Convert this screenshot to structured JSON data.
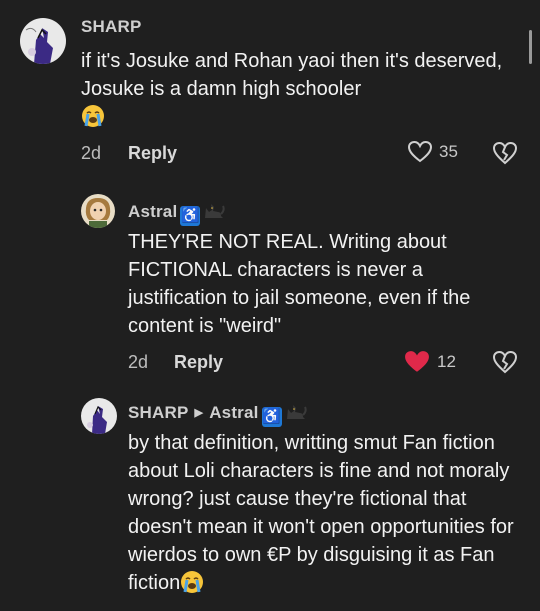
{
  "comments": [
    {
      "username": "SHARP",
      "text": "if it's Josuke and Rohan yaoi then it's deserved, Josuke is a damn high schooler",
      "time": "2d",
      "reply_label": "Reply",
      "likes": "35",
      "liked": false
    },
    {
      "username": "Astral",
      "badge": "♿",
      "text": "THEY'RE NOT REAL. Writing about FICTIONAL characters is never a justification to jail someone, even if the content is \"weird\"",
      "time": "2d",
      "reply_label": "Reply",
      "likes": "12",
      "liked": true
    },
    {
      "username": "SHARP",
      "reply_to": "Astral",
      "badge": "♿",
      "text": "by that definition, writting smut Fan fiction about Loli characters is fine and not moraly wrong? just cause they're fictional that doesn't mean it won't open opportunities for wierdos to own €P by disguising it as Fan fiction"
    }
  ],
  "icons": {
    "like": "heart-outline-icon",
    "liked": "heart-filled-icon",
    "dislike": "broken-heart-icon",
    "crying": "loudly-crying-face-emoji",
    "cat": "black-cat-emoji"
  },
  "colors": {
    "background": "#1f1f1f",
    "like_active": "#e0294a",
    "badge": "#1e78d6"
  }
}
